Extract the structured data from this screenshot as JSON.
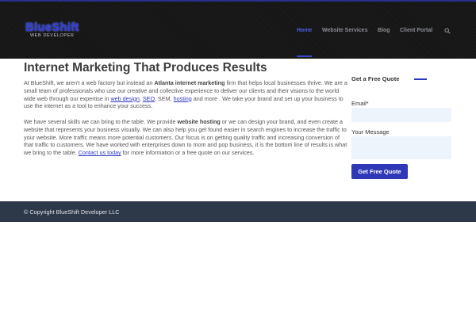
{
  "brand": {
    "name": "BlueShift",
    "tagline": "WEB DEVELOPER"
  },
  "nav": {
    "items": [
      "Home",
      "Website Services",
      "Blog",
      "Client Portal"
    ],
    "active": "Home",
    "search_icon": "search-icon"
  },
  "main": {
    "title": "Internet Marketing That Produces Results",
    "p1": {
      "t1": "At BlueShift, we aren't a web factory but instead an ",
      "b1": "Atlanta internet marketing",
      "t2": " firm that helps local businesses thrive. We are a small team of professionals who use our creative and collective experience to deliver our clients and their visions to the world wide web through our expertise in ",
      "l1": "web design",
      "t3": ", ",
      "l2": "SEO",
      "t4": ", SEM, ",
      "l3": "hosting",
      "t5": " and more . We take your brand and set up your business to use the internet as a tool to enhance your success."
    },
    "p2": {
      "t1": "We have several skills we can bring to the table. We provide ",
      "b1": "website hosting",
      "t2": " or we can design your brand, and even create a website that represents your business visually. We can also help you get found easier in search engines to increase the traffic to your website. More traffic means more potential customers. Our focus is on getting quality traffic and increasing conversion of that traffic to customers. We have worked with enterprises down to mom and pop business, it is the bottom line of results is what we bring to the table. ",
      "l1": "Contact us today",
      "t3": " for more information or a free quote on our services."
    }
  },
  "sidebar": {
    "title": "Get a Free Quote",
    "email_label": "Email*",
    "email_value": "",
    "message_label": "Your Message",
    "message_value": "",
    "button_label": "Get Free Quote"
  },
  "footer": {
    "copyright": "© Copyright BlueShift Developer LLC"
  },
  "colors": {
    "accent": "#2f38b6",
    "header_bg": "#151515",
    "footer_bg": "#2d3849",
    "link": "#2b35c4"
  }
}
